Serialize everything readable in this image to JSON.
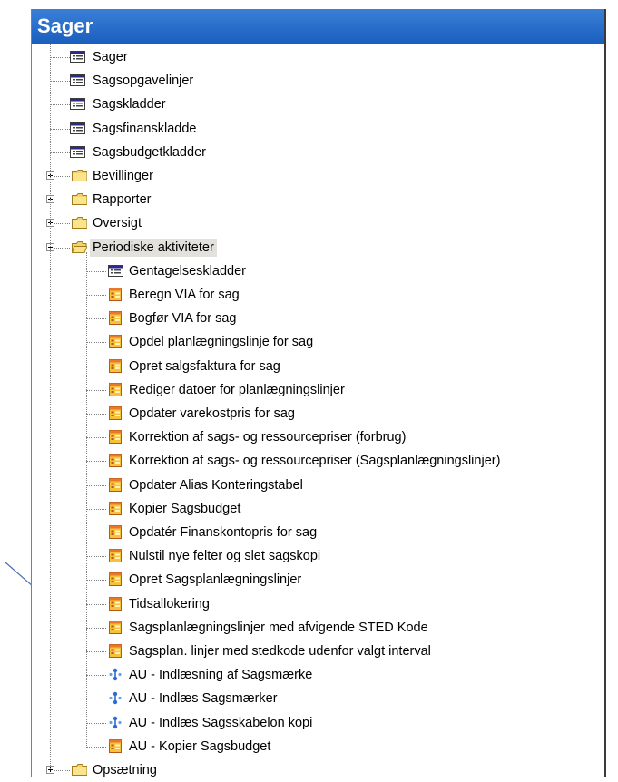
{
  "window": {
    "title": "Sager"
  },
  "tree": {
    "top_items": [
      {
        "label": "Sager",
        "icon": "form-icon"
      },
      {
        "label": "Sagsopgavelinjer",
        "icon": "form-icon"
      },
      {
        "label": "Sagskladder",
        "icon": "form-icon"
      },
      {
        "label": "Sagsfinanskladde",
        "icon": "form-icon"
      },
      {
        "label": "Sagsbudgetkladder",
        "icon": "form-icon"
      }
    ],
    "folders": [
      {
        "label": "Bevillinger",
        "expanded": false
      },
      {
        "label": "Rapporter",
        "expanded": false
      },
      {
        "label": "Oversigt",
        "expanded": false
      },
      {
        "label": "Periodiske aktiviteter",
        "expanded": true
      }
    ],
    "periodic_items": [
      {
        "label": "Gentagelseskladder",
        "icon": "form-icon"
      },
      {
        "label": "Beregn VIA for sag",
        "icon": "batch-job-icon"
      },
      {
        "label": "Bogfør VIA for sag",
        "icon": "batch-job-icon"
      },
      {
        "label": "Opdel planlægningslinje for sag",
        "icon": "batch-job-icon"
      },
      {
        "label": "Opret salgsfaktura for sag",
        "icon": "batch-job-icon"
      },
      {
        "label": "Rediger datoer for planlægningslinjer",
        "icon": "batch-job-icon"
      },
      {
        "label": "Opdater varekostpris for sag",
        "icon": "batch-job-icon"
      },
      {
        "label": "Korrektion af sags- og ressourcepriser (forbrug)",
        "icon": "batch-job-icon"
      },
      {
        "label": "Korrektion af sags- og ressourcepriser (Sagsplanlægningslinjer)",
        "icon": "batch-job-icon"
      },
      {
        "label": "Opdater Alias Konteringstabel",
        "icon": "batch-job-icon"
      },
      {
        "label": "Kopier Sagsbudget",
        "icon": "batch-job-icon"
      },
      {
        "label": "Opdatér Finanskontopris for sag",
        "icon": "batch-job-icon"
      },
      {
        "label": "Nulstil nye felter og slet sagskopi",
        "icon": "batch-job-icon"
      },
      {
        "label": "Opret Sagsplanlægningslinjer",
        "icon": "batch-job-icon"
      },
      {
        "label": "Tidsallokering",
        "icon": "batch-job-icon"
      },
      {
        "label": "Sagsplanlægningslinjer med afvigende STED Kode",
        "icon": "batch-job-icon"
      },
      {
        "label": "Sagsplan. linjer med stedkode udenfor valgt  interval",
        "icon": "batch-job-icon"
      },
      {
        "label": "AU - Indlæsning af Sagsmærke",
        "icon": "dataport-icon"
      },
      {
        "label": "AU - Indlæs Sagsmærker",
        "icon": "dataport-icon"
      },
      {
        "label": "AU - Indlæs Sagsskabelon kopi",
        "icon": "dataport-icon"
      },
      {
        "label": "AU - Kopier Sagsbudget",
        "icon": "batch-job-icon"
      }
    ],
    "bottom_folder": {
      "label": "Opsætning",
      "expanded": false
    }
  },
  "colors": {
    "titlebar": "#1b5fbf",
    "selection": "#e3e1dc",
    "arrow": "#4a6fb0"
  }
}
